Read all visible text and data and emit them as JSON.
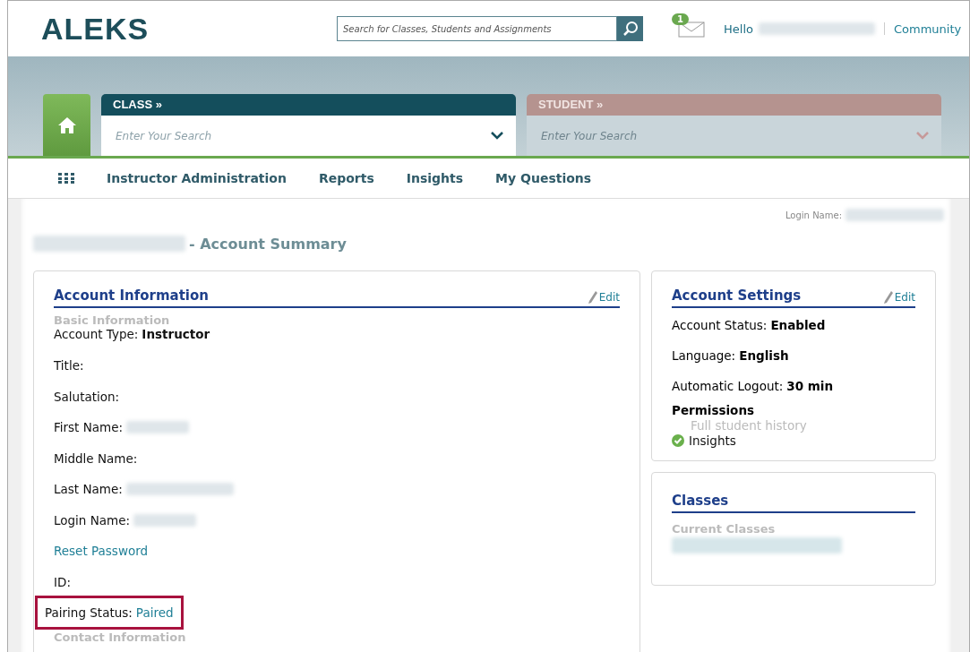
{
  "header": {
    "logo": "ALEKS",
    "search": {
      "placeholder": "Search for Classes, Students and Assignments"
    },
    "mail_badge": "1",
    "greeting": "Hello",
    "greeting_name_blurred": true,
    "community": "Community"
  },
  "selectors": [
    {
      "title": "CLASS »",
      "placeholder": "Enter Your Search",
      "disabled": false
    },
    {
      "title": "STUDENT »",
      "placeholder": "Enter Your Search",
      "disabled": true
    }
  ],
  "nav": {
    "items": [
      {
        "label": "Instructor Administration",
        "selected": false
      },
      {
        "label": "Reports",
        "selected": false
      },
      {
        "label": "Insights",
        "selected": false
      },
      {
        "label": "My Questions",
        "selected": false
      }
    ]
  },
  "page": {
    "title": "- Account Summary",
    "title_name_blurred": true,
    "login_label": "Login Name:",
    "login_blurred": true
  },
  "account_information": {
    "title": "Account Information",
    "edit": "Edit",
    "section": "Basic Information",
    "fields": [
      {
        "kind": "field",
        "label": "Account Type:",
        "value": "Instructor",
        "blurred": false,
        "highlighted": false
      },
      {
        "kind": "field",
        "label": "Title:",
        "blurred": false,
        "highlighted": false
      },
      {
        "kind": "field",
        "label": "Salutation:",
        "blurred": false,
        "highlighted": false
      },
      {
        "kind": "field",
        "label": "First Name:",
        "blurred": true,
        "highlighted": false
      },
      {
        "kind": "field",
        "label": "Middle Name:",
        "blurred": false,
        "highlighted": false
      },
      {
        "kind": "field",
        "label": "Last Name:",
        "blurred": true,
        "highlighted": false
      },
      {
        "kind": "field",
        "label": "Login Name:",
        "blurred": true,
        "highlighted": false
      },
      {
        "kind": "link",
        "label": "Reset Password"
      },
      {
        "kind": "field",
        "label": "ID:",
        "blurred": false,
        "highlighted": false
      },
      {
        "kind": "status",
        "label": "Pairing Status:",
        "value": "Paired",
        "highlighted": true
      }
    ],
    "next_section": "Contact Information"
  },
  "account_settings": {
    "title": "Account Settings",
    "edit": "Edit",
    "fields": [
      {
        "label": "Account Status:",
        "value": "Enabled"
      },
      {
        "label": "Language:",
        "value": "English"
      },
      {
        "label": "Automatic Logout:",
        "value": "30 min"
      }
    ],
    "permissions_title": "Permissions",
    "permissions": [
      {
        "label": "Full student history",
        "granted": false
      },
      {
        "label": "Insights",
        "granted": true
      }
    ]
  },
  "classes": {
    "title": "Classes",
    "section": "Current Classes",
    "list_blurred": true
  }
}
